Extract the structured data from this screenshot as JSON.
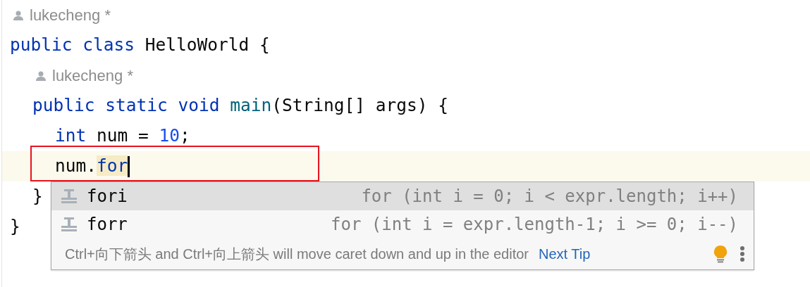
{
  "editor": {
    "lines": [
      {
        "author": "lukecheng *",
        "current": false,
        "annotated": false,
        "caret": false,
        "tokens": [
          {
            "text": "public",
            "kind": "keyword",
            "space_after": true
          },
          {
            "text": "class",
            "kind": "keyword",
            "space_after": true
          },
          {
            "text": "HelloWorld",
            "kind": "plain",
            "space_after": true
          },
          {
            "text": "{",
            "kind": "plain",
            "space_after": false
          }
        ],
        "children": [
          {
            "author": "lukecheng *",
            "current": false,
            "annotated": false,
            "caret": false,
            "tokens": [
              {
                "text": "public",
                "kind": "keyword",
                "space_after": true
              },
              {
                "text": "static",
                "kind": "keyword",
                "space_after": true
              },
              {
                "text": "void",
                "kind": "keyword",
                "space_after": true
              },
              {
                "text": "main",
                "kind": "method",
                "space_after": false
              },
              {
                "text": "(String[]",
                "kind": "plain",
                "space_after": true
              },
              {
                "text": "args)",
                "kind": "plain",
                "space_after": true
              },
              {
                "text": "{",
                "kind": "plain",
                "space_after": false
              }
            ],
            "children": [
              {
                "current": false,
                "annotated": false,
                "caret": false,
                "tokens": [
                  {
                    "text": "int",
                    "kind": "keyword",
                    "space_after": true
                  },
                  {
                    "text": "num",
                    "kind": "plain",
                    "space_after": true
                  },
                  {
                    "text": "=",
                    "kind": "plain",
                    "space_after": true
                  },
                  {
                    "text": "10",
                    "kind": "number",
                    "space_after": false
                  },
                  {
                    "text": ";",
                    "kind": "plain",
                    "space_after": false
                  }
                ]
              },
              {
                "current": true,
                "annotated": true,
                "caret": true,
                "tokens": [
                  {
                    "text": "num.",
                    "kind": "plain",
                    "space_after": false
                  },
                  {
                    "text": "for",
                    "kind": "template",
                    "space_after": false
                  }
                ]
              }
            ]
          },
          {
            "current": false,
            "annotated": false,
            "caret": false,
            "tokens": [
              {
                "text": "}",
                "kind": "plain",
                "space_after": false
              }
            ]
          }
        ]
      },
      {
        "current": false,
        "annotated": false,
        "caret": false,
        "tokens": [
          {
            "text": "}",
            "kind": "plain",
            "space_after": false
          }
        ]
      }
    ]
  },
  "completion": {
    "items": [
      {
        "name": "fori",
        "description": "for (int i = 0; i < expr.length; i++)",
        "selected": true
      },
      {
        "name": "forr",
        "description": "for (int i = expr.length-1; i >= 0; i--)",
        "selected": false
      }
    ],
    "tip": "Ctrl+向下箭头 and Ctrl+向上箭头 will move caret down and up in the editor",
    "next_tip": "Next Tip"
  }
}
